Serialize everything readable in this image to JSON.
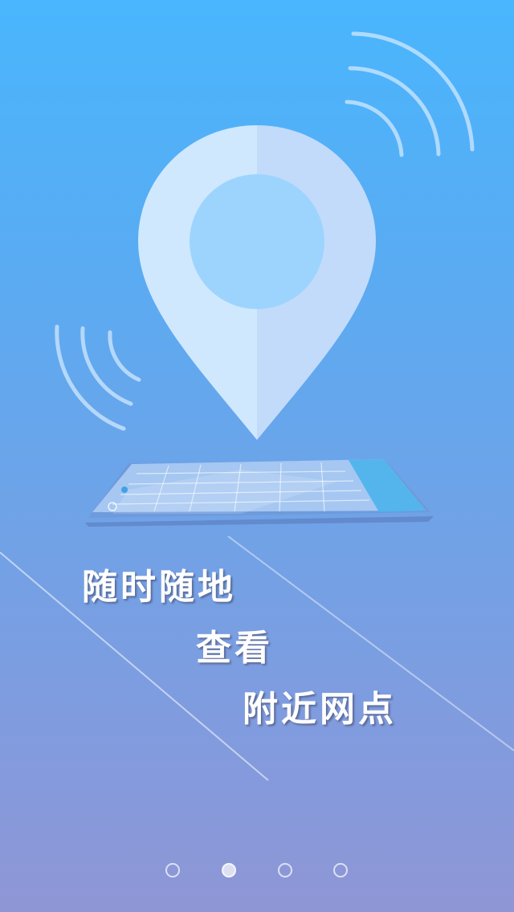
{
  "guide": {
    "headline": {
      "line1": "随时随地",
      "line2": "查看",
      "line3": "附近网点"
    },
    "illustration": {
      "pin_icon": "location-pin-icon",
      "signal_icon": "signal-wave-icon",
      "phone_icon": "tilted-phone-screen"
    }
  },
  "pager": {
    "total": 4,
    "active_index": 1
  },
  "colors": {
    "bg_top": "#49b6fd",
    "bg_bottom": "#8f96d6",
    "pin_light": "#cfe8fd",
    "pin_shade": "#c2dbfa",
    "pin_center": "#9dd4fd"
  }
}
